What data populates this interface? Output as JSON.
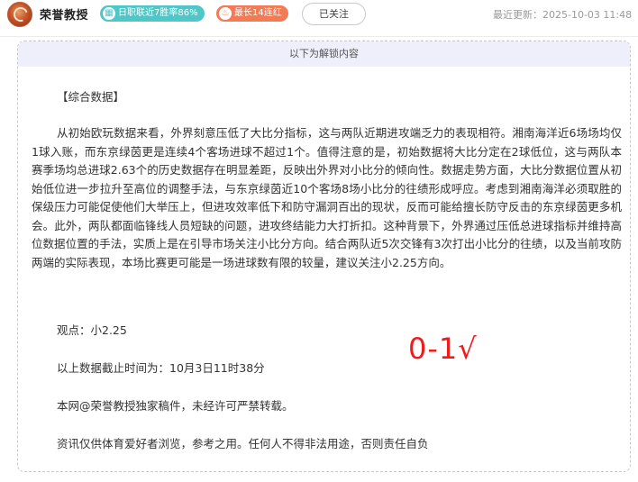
{
  "header": {
    "author_name": "荣誉教授",
    "badge_streak_text": "日职联近7胜率86%",
    "badge_streak_icon": "calendar-icon",
    "badge_max_text": "最长14连红",
    "badge_max_icon": "flame-icon",
    "follow_label": "已关注",
    "update_time": "最近更新：2025-10-03 11:48",
    "colors": {
      "teal": "#4fc7c8",
      "orange": "#f27b56",
      "result_red": "#ee1c1c"
    }
  },
  "card": {
    "unlock_label": "以下为解锁内容",
    "section_title": "【综合数据】",
    "analysis": "从初始欧玩数据来看，外界刻意压低了大比分指标，这与两队近期进攻端乏力的表现相符。湘南海洋近6场场均仅1球入账，而东京绿茵更是连续4个客场进球不超过1个。值得注意的是，初始数据将大比分定在2球低位，这与两队本赛季场均总进球2.63个的历史数据存在明显差距，反映出外界对小比分的倾向性。数据走势方面，大比分数据位置从初始低位进一步拉升至高位的调整手法，与东京绿茵近10个客场8场小比分的往绩形成呼应。考虑到湘南海洋必须取胜的保级压力可能促使他们大举压上，但进攻效率低下和防守漏洞百出的现状，反而可能给擅长防守反击的东京绿茵更多机会。此外，两队都面临锋线人员短缺的问题，进攻终结能力大打折扣。这种背景下，外界通过压低总进球指标并维持高位数据位置的手法，实质上是在引导市场关注小比分方向。结合两队近5次交锋有3次打出小比分的往绩，以及当前攻防两端的实际表现，本场比赛更可能是一场进球数有限的较量，建议关注小2.25方向。",
    "view": "观点：小2.25",
    "result": "0-1√",
    "cutoff": "以上数据截止时间为：10月3日11时38分",
    "copyright": "本网@荣誉教授独家稿件，未经许可严禁转载。",
    "disclaimer": "资讯仅供体育爱好者浏览，参考之用。任何人不得非法用途，否则责任自负"
  }
}
